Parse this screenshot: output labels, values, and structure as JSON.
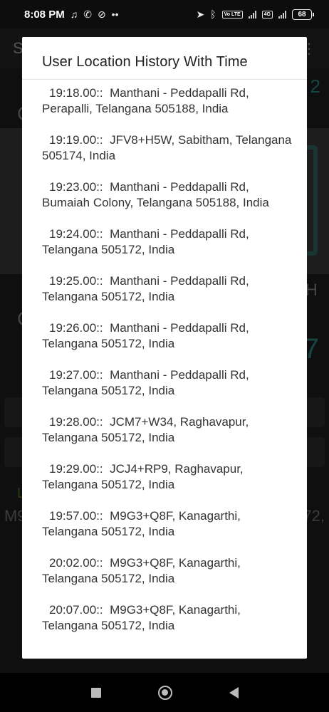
{
  "status_bar": {
    "time": "8:08 PM",
    "icons_left": [
      "music-note-icon",
      "whatsapp-icon",
      "do-not-disturb-icon",
      "more-dots-icon"
    ],
    "icons_right": [
      "location-arrow-icon",
      "bluetooth-icon",
      "volte-icon",
      "signal-icon",
      "4g-icon",
      "signal-icon"
    ],
    "lte_label": "Vo LTE",
    "network_label": "4G",
    "battery": "68"
  },
  "background_app": {
    "title_initial": "S",
    "partial_number": "2",
    "partial_letter_c": "C",
    "partial_letter_h": "H",
    "partial_seven": "7",
    "partial_l": "L",
    "partial_m9": "M9",
    "partial_72": "72,"
  },
  "dialog": {
    "title": "User Location History With Time",
    "items": [
      {
        "time": "19:18.00::",
        "location": "Manthani - Peddapalli Rd, Perapalli, Telangana 505188, India"
      },
      {
        "time": "19:19.00::",
        "location": "JFV8+H5W, Sabitham, Telangana 505174, India"
      },
      {
        "time": "19:23.00::",
        "location": "Manthani - Peddapalli Rd, Bumaiah Colony, Telangana 505188, India"
      },
      {
        "time": "19:24.00::",
        "location": "Manthani - Peddapalli Rd, Telangana 505172, India"
      },
      {
        "time": "19:25.00::",
        "location": "Manthani - Peddapalli Rd, Telangana 505172, India"
      },
      {
        "time": "19:26.00::",
        "location": "Manthani - Peddapalli Rd, Telangana 505172, India"
      },
      {
        "time": "19:27.00::",
        "location": "Manthani - Peddapalli Rd, Telangana 505172, India"
      },
      {
        "time": "19:28.00::",
        "location": "JCM7+W34, Raghavapur, Telangana 505172, India"
      },
      {
        "time": "19:29.00::",
        "location": "JCJ4+RP9, Raghavapur, Telangana 505172, India"
      },
      {
        "time": "19:57.00::",
        "location": "M9G3+Q8F, Kanagarthi, Telangana 505172, India"
      },
      {
        "time": "20:02.00::",
        "location": "M9G3+Q8F, Kanagarthi, Telangana 505172, India"
      },
      {
        "time": "20:07.00::",
        "location": "M9G3+Q8F, Kanagarthi, Telangana 505172, India"
      }
    ]
  },
  "nav_bar": {
    "icons": [
      "recents-square-icon",
      "home-circle-icon",
      "back-triangle-icon"
    ]
  }
}
